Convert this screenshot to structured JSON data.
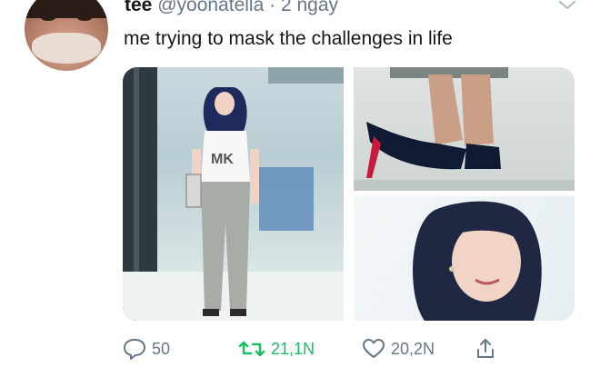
{
  "tweet": {
    "author_name": "tee",
    "handle": "@yoonatella",
    "separator": "·",
    "time": "2 ngày",
    "text": "me trying to mask the challenges in life"
  },
  "media": {
    "images": [
      {
        "label": "photo-1"
      },
      {
        "label": "photo-2"
      },
      {
        "label": "photo-3"
      }
    ]
  },
  "actions": {
    "reply_count": "50",
    "retweet_count": "21,1N",
    "like_count": "20,2N"
  },
  "colors": {
    "text": "#14171a",
    "secondary": "#657786",
    "retweet_active": "#17bf63"
  }
}
